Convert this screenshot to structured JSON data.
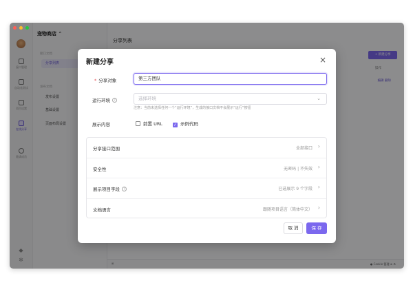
{
  "app": {
    "project_name": "宠物商店 ⌃",
    "page_title": "分享列表",
    "new_share_button": "+ 新建分享",
    "column_ops": "操作",
    "row_actions": "编辑  删除",
    "rail": [
      "接口管理",
      "自动化测试",
      "项目设置",
      "在线分享",
      "邀请成员"
    ],
    "nav": {
      "group1": "接口文档",
      "active_item": "分享列表",
      "group2": "发布文档",
      "items": [
        "发布设置",
        "基础设置",
        "页面布局设置"
      ]
    },
    "status_left": "⊞",
    "status_right": "● Cookie 管理   ⊕   ⚙"
  },
  "modal": {
    "title": "新建分享",
    "close_icon": "×",
    "share_target_label": "分享对象",
    "share_target_value": "第三方团队",
    "env_label": "运行环境",
    "env_placeholder": "选择环境",
    "env_note": "注意：当前未选择任何一个“运行环境”，生成的接口文档不会展示“运行”按钮",
    "display_label": "展示内容",
    "checkbox_url": "前置 URL",
    "checkbox_url_checked": false,
    "checkbox_code": "示例代码",
    "checkbox_code_checked": true,
    "settings": [
      {
        "key": "分享接口范围",
        "value": "全部接口",
        "help": false
      },
      {
        "key": "安全性",
        "value": "无密码 | 不失效",
        "help": false
      },
      {
        "key": "展示项目字段",
        "value": "已选展示 9 个字段",
        "help": true
      },
      {
        "key": "文档语言",
        "value": "跟随项目语言（简体中文）",
        "help": false
      }
    ],
    "cancel_label": "取 消",
    "save_label": "保 存"
  },
  "colors": {
    "accent": "#7b68ee",
    "required": "#e5484d",
    "overlay": "rgba(0,0,0,0.44)"
  }
}
